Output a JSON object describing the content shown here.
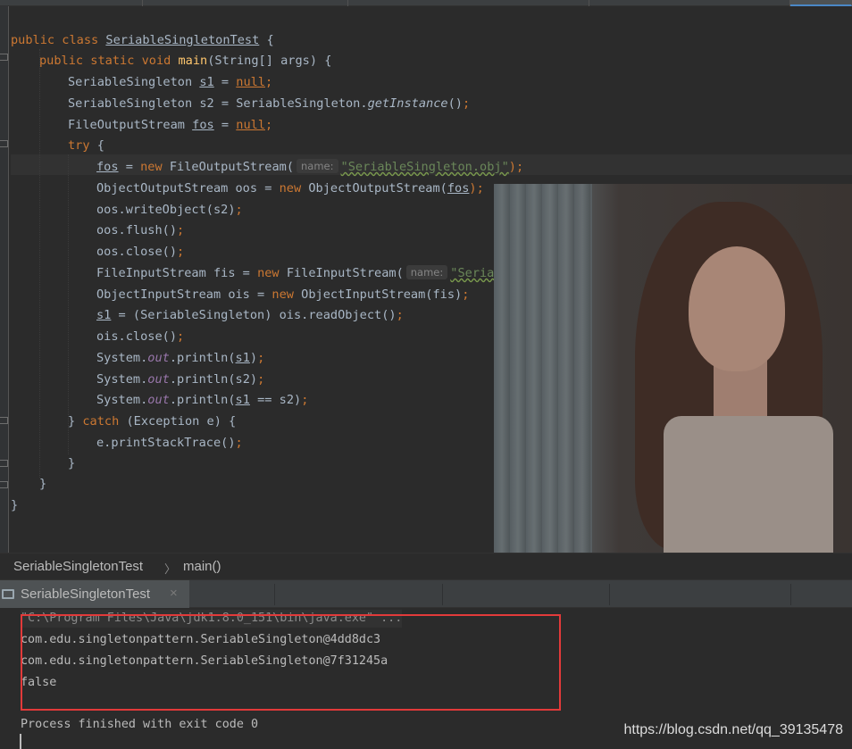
{
  "editor": {
    "lines": {
      "l1": {
        "kw1": "public ",
        "kw2": "class ",
        "cls": "SeriableSingletonTest",
        "rest": " {"
      },
      "l2": {
        "kw": "public static void ",
        "fn": "main",
        "rest": "(String[] args) {"
      },
      "l3": {
        "type": "SeriableSingleton ",
        "var": "s1",
        "eq": " = ",
        "val": "null",
        "end": ";"
      },
      "l4": {
        "pre": "SeriableSingleton s2 = SeriableSingleton.",
        "call": "getInstance",
        "post": "()",
        "end": ";"
      },
      "l5": {
        "type": "FileOutputStream ",
        "var": "fos",
        "eq": " = ",
        "val": "null",
        "end": ";"
      },
      "l6": {
        "kw": "try",
        "rest": " {"
      },
      "l7": {
        "var": "fos",
        "eq": " = ",
        "kw": "new ",
        "cls": "FileOutputStream(",
        "hint": "name:",
        "str": "\"SeriableSingleton.obj\"",
        "end": ");"
      },
      "l8": {
        "pre": "ObjectOutputStream oos = ",
        "kw": "new ",
        "cls": "ObjectOutputStream(",
        "var": "fos",
        "end": ");"
      },
      "l9": {
        "text": "oos.writeObject(s2)",
        "end": ";"
      },
      "l10": {
        "text": "oos.flush()",
        "end": ";"
      },
      "l11": {
        "text": "oos.close()",
        "end": ";"
      },
      "l12": {
        "pre": "FileInputStream fis = ",
        "kw": "new ",
        "cls": "FileInputStream(",
        "hint": "name:",
        "str": "\"SeriableSingleton.obj\"",
        "end": ");"
      },
      "l13": {
        "pre": "ObjectInputStream ois = ",
        "kw": "new ",
        "cls": "ObjectInputStream(fis)",
        "end": ";"
      },
      "l14": {
        "var": "s1",
        "rest": " = (SeriableSingleton) ois.readObject()",
        "end": ";"
      },
      "l15": {
        "text": "ois.close()",
        "end": ";"
      },
      "l16": {
        "pre": "System.",
        "stat": "out",
        "mid": ".println(",
        "var": "s1",
        "post": ")",
        "end": ";"
      },
      "l17": {
        "pre": "System.",
        "stat": "out",
        "mid": ".println(s2)",
        "end": ";"
      },
      "l18": {
        "pre": "System.",
        "stat": "out",
        "mid": ".println(",
        "var": "s1",
        "post": " == s2)",
        "end": ";"
      },
      "l19": {
        "pre": "} ",
        "kw": "catch",
        "rest": " (Exception e) {"
      },
      "l20": {
        "text": "e.printStackTrace()",
        "end": ";"
      },
      "l21": {
        "text": "}"
      },
      "l22": {
        "text": "}"
      },
      "l23": {
        "text": "}"
      }
    }
  },
  "breadcrumb": {
    "class_name": "SeriableSingletonTest",
    "separator": "〉",
    "method": "main()"
  },
  "run_panel": {
    "tab_label": "SeriableSingletonTest",
    "close_glyph": "×",
    "console": {
      "command": "\"C:\\Program Files\\Java\\jdk1.8.0_151\\bin\\java.exe\" ...",
      "output1": "com.edu.singletonpattern.SeriableSingleton@4dd8dc3",
      "output2": "com.edu.singletonpattern.SeriableSingleton@7f31245a",
      "output3": "false",
      "exit_message": "Process finished with exit code 0"
    }
  },
  "watermark": "https://blog.csdn.net/qq_39135478",
  "colors": {
    "keyword": "#cc7832",
    "function": "#ffc66d",
    "string": "#6a8759",
    "static_field": "#9876aa",
    "text": "#a9b7c6",
    "highlight_box": "#e23a3a"
  },
  "icons": {
    "run_tab_icon": "console-icon",
    "fold_markers": "fold-marker-icon"
  }
}
